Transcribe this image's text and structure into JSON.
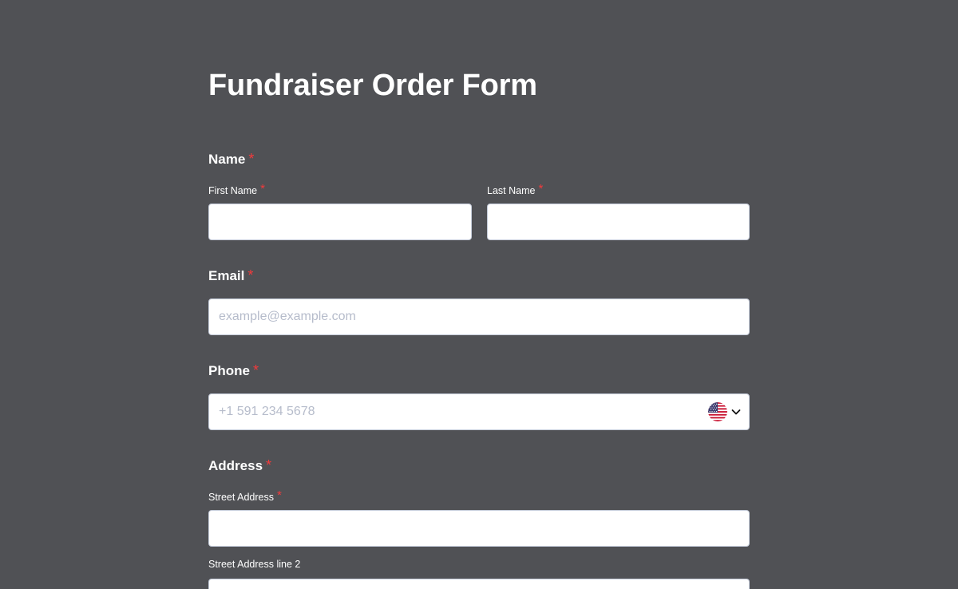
{
  "form": {
    "title": "Fundraiser Order Form",
    "required_marker": "*"
  },
  "name": {
    "label": "Name",
    "first": {
      "label": "First Name",
      "value": ""
    },
    "last": {
      "label": "Last Name",
      "value": ""
    }
  },
  "email": {
    "label": "Email",
    "placeholder": "example@example.com",
    "value": ""
  },
  "phone": {
    "label": "Phone",
    "placeholder": "+1 591 234 5678",
    "value": "",
    "country_icon": "us-flag-icon"
  },
  "address": {
    "label": "Address",
    "street1": {
      "label": "Street Address",
      "value": ""
    },
    "street2": {
      "label": "Street Address line 2",
      "value": ""
    }
  },
  "colors": {
    "background": "#505155",
    "required": "#f23a3c",
    "field_background": "#ffffff",
    "placeholder": "#b6bccb"
  }
}
